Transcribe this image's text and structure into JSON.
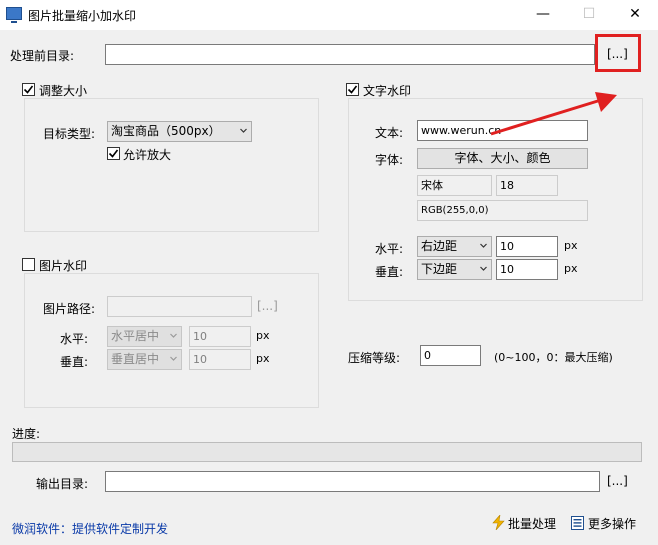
{
  "window": {
    "title": "图片批量缩小加水印",
    "minimize": "—",
    "maximize": "☐",
    "close": "✕"
  },
  "source": {
    "label": "处理前目录:",
    "value": "",
    "browse_label": "[...]"
  },
  "resize": {
    "checkbox_label": "调整大小",
    "checked": true,
    "target_type_label": "目标类型:",
    "target_type_value": "淘宝商品（500px）",
    "allow_enlarge_label": "允许放大",
    "allow_enlarge_checked": true
  },
  "text_watermark": {
    "checkbox_label": "文字水印",
    "checked": true,
    "text_label": "文本:",
    "text_value": "www.werun.cn",
    "font_label": "字体:",
    "font_button": "字体、大小、颜色",
    "font_name": "宋体",
    "font_size": "18",
    "font_color": "RGB(255,0,0)",
    "horizontal_label": "水平:",
    "horizontal_value": "右边距",
    "horizontal_offset": "10",
    "vertical_label": "垂直:",
    "vertical_value": "下边距",
    "vertical_offset": "10",
    "unit": "px"
  },
  "image_watermark": {
    "checkbox_label": "图片水印",
    "checked": false,
    "path_label": "图片路径:",
    "path_value": "",
    "browse_label": "[...]",
    "horizontal_label": "水平:",
    "horizontal_value": "水平居中",
    "horizontal_offset": "10",
    "vertical_label": "垂直:",
    "vertical_value": "垂直居中",
    "vertical_offset": "10",
    "unit": "px"
  },
  "compression": {
    "label": "压缩等级:",
    "value": "0",
    "hint": "(0~100，0：最大压缩)"
  },
  "progress": {
    "label": "进度:",
    "fraction": 0
  },
  "output": {
    "label": "输出目录:",
    "value": "",
    "browse_label": "[...]"
  },
  "footer": {
    "company_text": "微润软件：提供软件定制开发",
    "batch_label": "批量处理",
    "more_label": "更多操作"
  },
  "colors": {
    "highlight_red": "#e02020",
    "link_blue": "#0a3aa8"
  }
}
